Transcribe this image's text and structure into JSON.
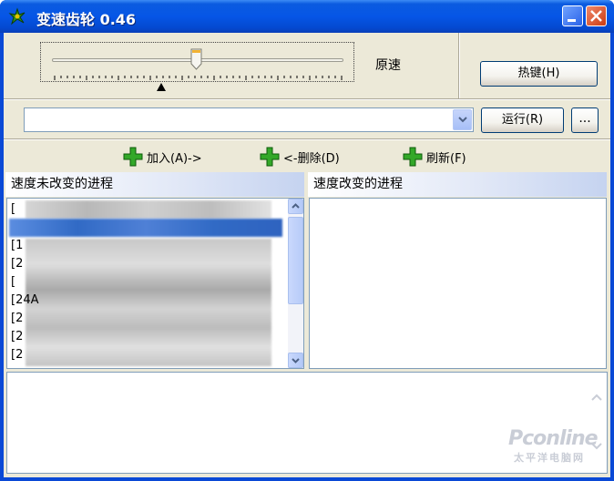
{
  "window": {
    "title": "变速齿轮 0.46"
  },
  "speed": {
    "label": "原速"
  },
  "buttons": {
    "hotkey": "热键(H)",
    "run": "运行(R)",
    "more": "..."
  },
  "combo": {
    "value": ""
  },
  "actions": {
    "add": "加入(A)->",
    "remove": "<-删除(D)",
    "refresh": "刷新(F)"
  },
  "panels": {
    "left_title": "速度未改变的进程",
    "right_title": "速度改变的进程",
    "left_items": [
      "[",
      "",
      "[1",
      "[2",
      "[",
      "[24A",
      "[2",
      "[2",
      "[2"
    ]
  },
  "watermark": {
    "brand": "Pconline",
    "sub": "太平洋电脑网"
  },
  "colors": {
    "title_bar": "#0656e6",
    "face": "#ece9d8",
    "selection": "#316ac5"
  }
}
